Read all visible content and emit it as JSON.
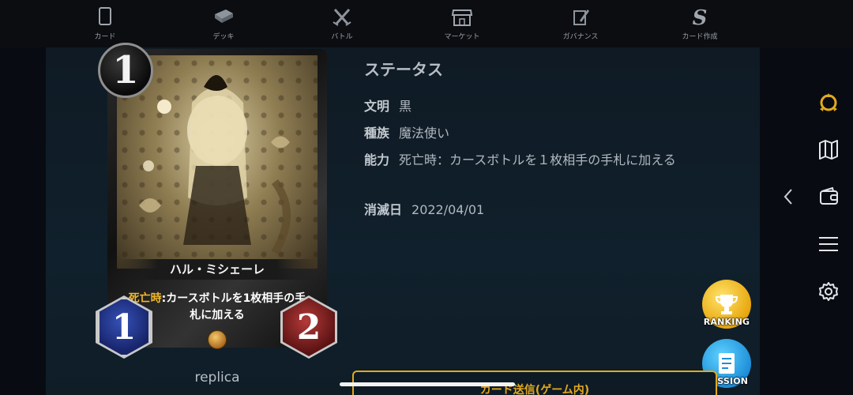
{
  "nav": {
    "items": [
      {
        "label": "カード",
        "icon": "card-icon"
      },
      {
        "label": "デッキ",
        "icon": "deck-icon"
      },
      {
        "label": "バトル",
        "icon": "battle-swords-icon"
      },
      {
        "label": "マーケット",
        "icon": "market-shop-icon"
      },
      {
        "label": "ガバナンス",
        "icon": "governance-pen-icon"
      },
      {
        "label": "カード作成",
        "icon": "card-create-s-icon"
      }
    ]
  },
  "card": {
    "cost": "1",
    "name": "ハル・ミシェーレ",
    "ability_keyword": "死亡時",
    "ability_text": ":カースボトルを1枚相手の手札に加える",
    "attack": "1",
    "defense": "2",
    "caption": "replica"
  },
  "status": {
    "title": "ステータス",
    "rows": [
      {
        "key": "文明",
        "value": "黒"
      },
      {
        "key": "種族",
        "value": "魔法使い"
      },
      {
        "key": "能力",
        "value": "死亡時：カースボトルを１枚相手の手札に加える"
      },
      {
        "key": "消滅日",
        "value": "2022/04/01"
      }
    ]
  },
  "actions": {
    "ranking_label": "RANKING",
    "mission_label": "MISSION",
    "send_label": "カード送信(ゲーム内)"
  },
  "rail": {
    "icons": [
      "ring-logo-icon",
      "map-icon",
      "chevron-left-icon",
      "wallet-icon",
      "menu-icon",
      "gear-icon"
    ]
  },
  "colors": {
    "accent_gold": "#e3a91f",
    "background": "#0f1a24",
    "attack_blue": "#18246a",
    "defense_red": "#5a1212"
  }
}
